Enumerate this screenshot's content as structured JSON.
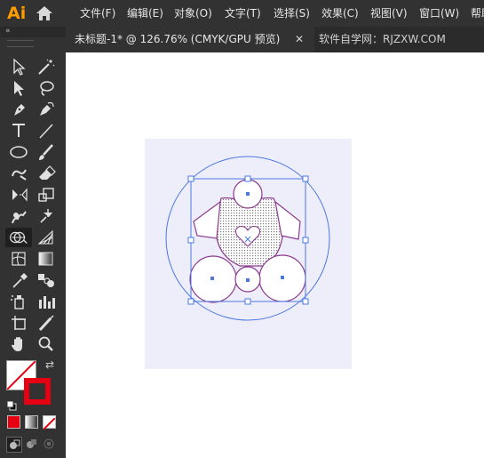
{
  "app": {
    "logo_text": "Ai",
    "accent_color": "#ff9a00"
  },
  "menu": {
    "items": [
      "文件(F)",
      "编辑(E)",
      "对象(O)",
      "文字(T)",
      "选择(S)",
      "效果(C)",
      "视图(V)",
      "窗口(W)",
      "帮助"
    ]
  },
  "tabs": {
    "active": "未标题-1* @ 126.76% (CMYK/GPU 预览)",
    "close_glyph": "✕",
    "second": "软件自学网：RJZXW.COM"
  },
  "toolbar": {
    "collapse_glyph": "«",
    "icons": [
      "selection-tool-icon",
      "direct-selection-tool-icon",
      "magic-wand-tool-icon",
      "lasso-tool-icon",
      "pen-tool-icon",
      "curvature-tool-icon",
      "type-tool-icon",
      "line-segment-tool-icon",
      "ellipse-tool-icon",
      "paintbrush-tool-icon",
      "shaper-tool-icon",
      "eraser-tool-icon",
      "rotate-tool-icon",
      "scale-tool-icon",
      "warp-tool-icon",
      "free-transform-tool-icon",
      "shape-builder-tool-icon",
      "perspective-grid-tool-icon",
      "mesh-tool-icon",
      "gradient-tool-icon",
      "eyedropper-tool-icon",
      "blend-tool-icon",
      "symbol-sprayer-tool-icon",
      "column-graph-tool-icon",
      "artboard-tool-icon",
      "slice-tool-icon",
      "hand-tool-icon",
      "zoom-tool-icon"
    ],
    "active_tool": "shape-builder-tool-icon"
  },
  "colors": {
    "fill": "none",
    "stroke": "#e60012",
    "artboard_bg": "#eeeefa",
    "selection": "#4a78e0",
    "path": "#8b3a8f"
  }
}
